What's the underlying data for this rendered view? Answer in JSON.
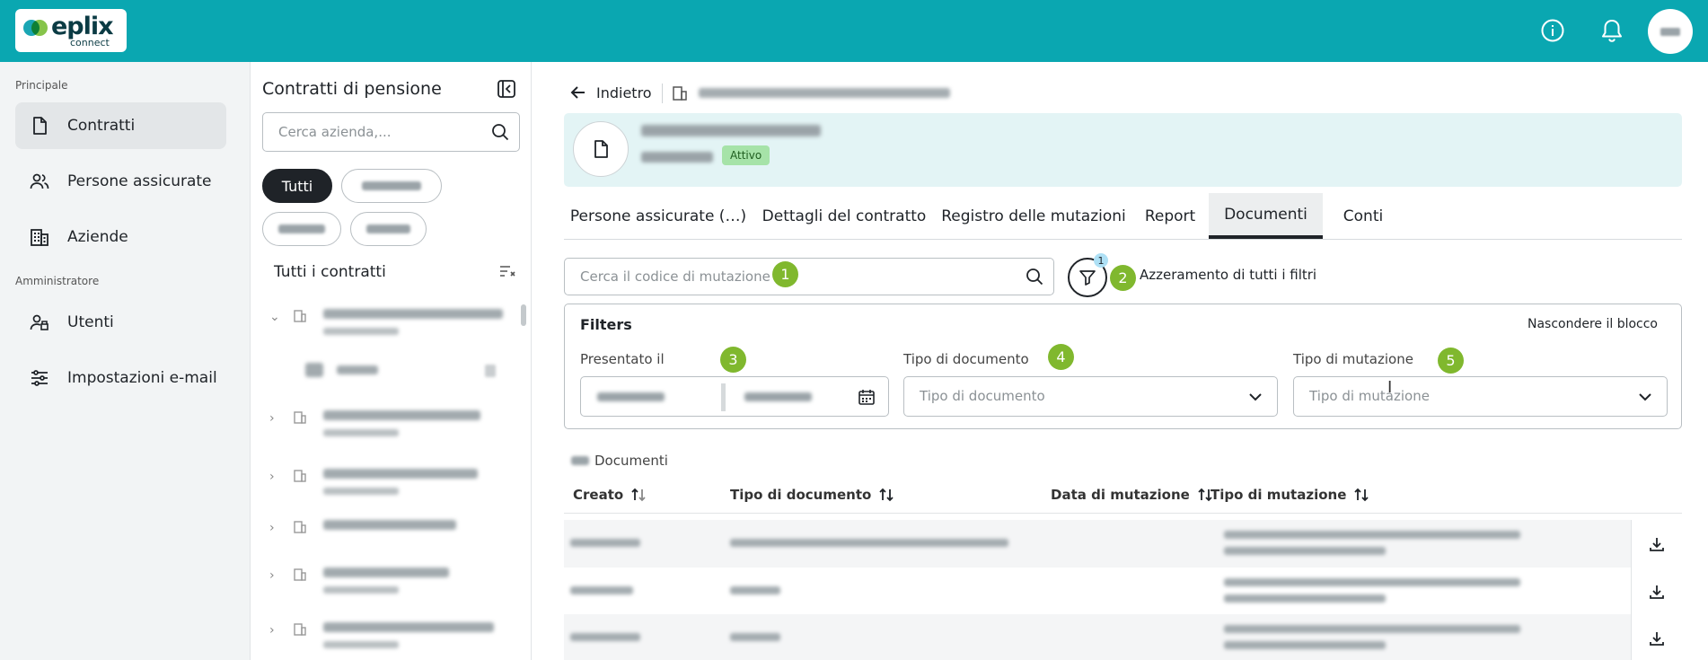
{
  "topbar": {
    "logo_word": "eplix",
    "logo_sub": "connect",
    "info_icon": "info-icon",
    "bell_icon": "bell-icon",
    "colors": {
      "bar": "#0aa7b1"
    }
  },
  "nav": {
    "section_main": "Principale",
    "section_admin": "Amministratore",
    "items": [
      {
        "label": "Contratti",
        "icon": "document-icon",
        "active": true
      },
      {
        "label": "Persone assicurate",
        "icon": "people-icon",
        "active": false
      },
      {
        "label": "Aziende",
        "icon": "building-icon",
        "active": false
      },
      {
        "label": "Utenti",
        "icon": "users-icon",
        "active": false
      },
      {
        "label": "Impostazioni e-mail",
        "icon": "sliders-icon",
        "active": false
      }
    ]
  },
  "panel": {
    "title": "Contratti di pensione",
    "search_placeholder": "Cerca azienda,...",
    "chip_all": "Tutti",
    "section_title": "Tutti i contratti"
  },
  "main": {
    "back_label": "Indietro",
    "status_badge": "Attivo",
    "tabs": [
      {
        "label": "Persone assicurate (…)"
      },
      {
        "label": "Dettagli del contratto"
      },
      {
        "label": "Registro delle mutazioni"
      },
      {
        "label": "Report"
      },
      {
        "label": "Documenti",
        "active": true
      },
      {
        "label": "Conti"
      }
    ],
    "search_placeholder": "Cerca il codice di mutazione",
    "filter_count": "1",
    "reset_label": "Azzeramento di tutti i filtri",
    "filters": {
      "title": "Filters",
      "hide_label": "Nascondere il blocco",
      "presented_label": "Presentato il",
      "doc_type_label": "Tipo di documento",
      "doc_type_placeholder": "Tipo di documento",
      "mutation_type_label": "Tipo di mutazione",
      "mutation_type_placeholder": "Tipo di mutazione"
    },
    "markers": [
      "1",
      "2",
      "3",
      "4",
      "5"
    ],
    "documents_label": "Documenti",
    "table": {
      "columns": [
        "Creato",
        "Tipo di documento",
        "Data di mutazione",
        "Tipo di mutazione"
      ]
    }
  }
}
